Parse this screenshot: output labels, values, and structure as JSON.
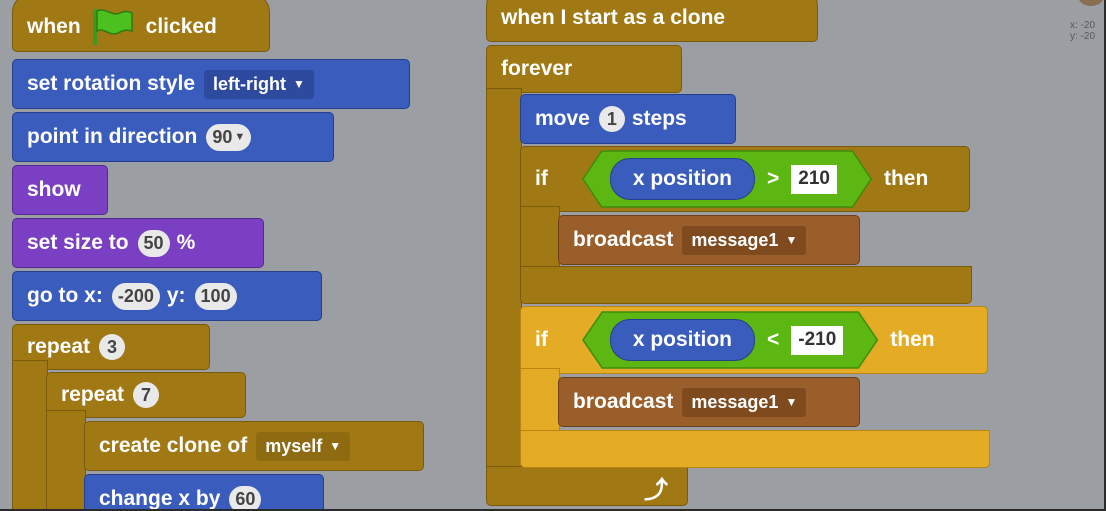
{
  "stage_corner": {
    "x_label": "x: -20",
    "y_label": "y: -20"
  },
  "script1": {
    "hat": {
      "when": "when",
      "flag_icon": "green-flag",
      "clicked": "clicked"
    },
    "rotation": {
      "label": "set rotation style",
      "value": "left-right"
    },
    "direction": {
      "label": "point in direction",
      "value": "90"
    },
    "show": {
      "label": "show"
    },
    "size": {
      "label": "set size to",
      "value": "50",
      "unit": "%"
    },
    "goto": {
      "label_x": "go to x:",
      "x": "-200",
      "label_y": "y:",
      "y": "100"
    },
    "repeat_outer": {
      "label": "repeat",
      "value": "3"
    },
    "repeat_inner": {
      "label": "repeat",
      "value": "7"
    },
    "clone": {
      "label": "create clone of",
      "value": "myself"
    },
    "changex": {
      "label": "change x by",
      "value": "60"
    }
  },
  "script2": {
    "hat": {
      "label": "when I start as a clone"
    },
    "forever": {
      "label": "forever"
    },
    "move": {
      "label": "move",
      "value": "1",
      "unit": "steps"
    },
    "if1": {
      "if": "if",
      "reporter": "x position",
      "op": ">",
      "value": "210",
      "then": "then",
      "broadcast": "broadcast",
      "message": "message1"
    },
    "if2": {
      "if": "if",
      "reporter": "x position",
      "op": "<",
      "value": "-210",
      "then": "then",
      "broadcast": "broadcast",
      "message": "message1"
    },
    "loop_arrow_icon": "loop-arrow"
  },
  "colors": {
    "events": "#a07915",
    "motion": "#3a5dbd",
    "looks": "#7a3fc2",
    "operators": "#5cb712",
    "control_highlight": "#e3ac24",
    "canvas": "#9b9ea2"
  }
}
